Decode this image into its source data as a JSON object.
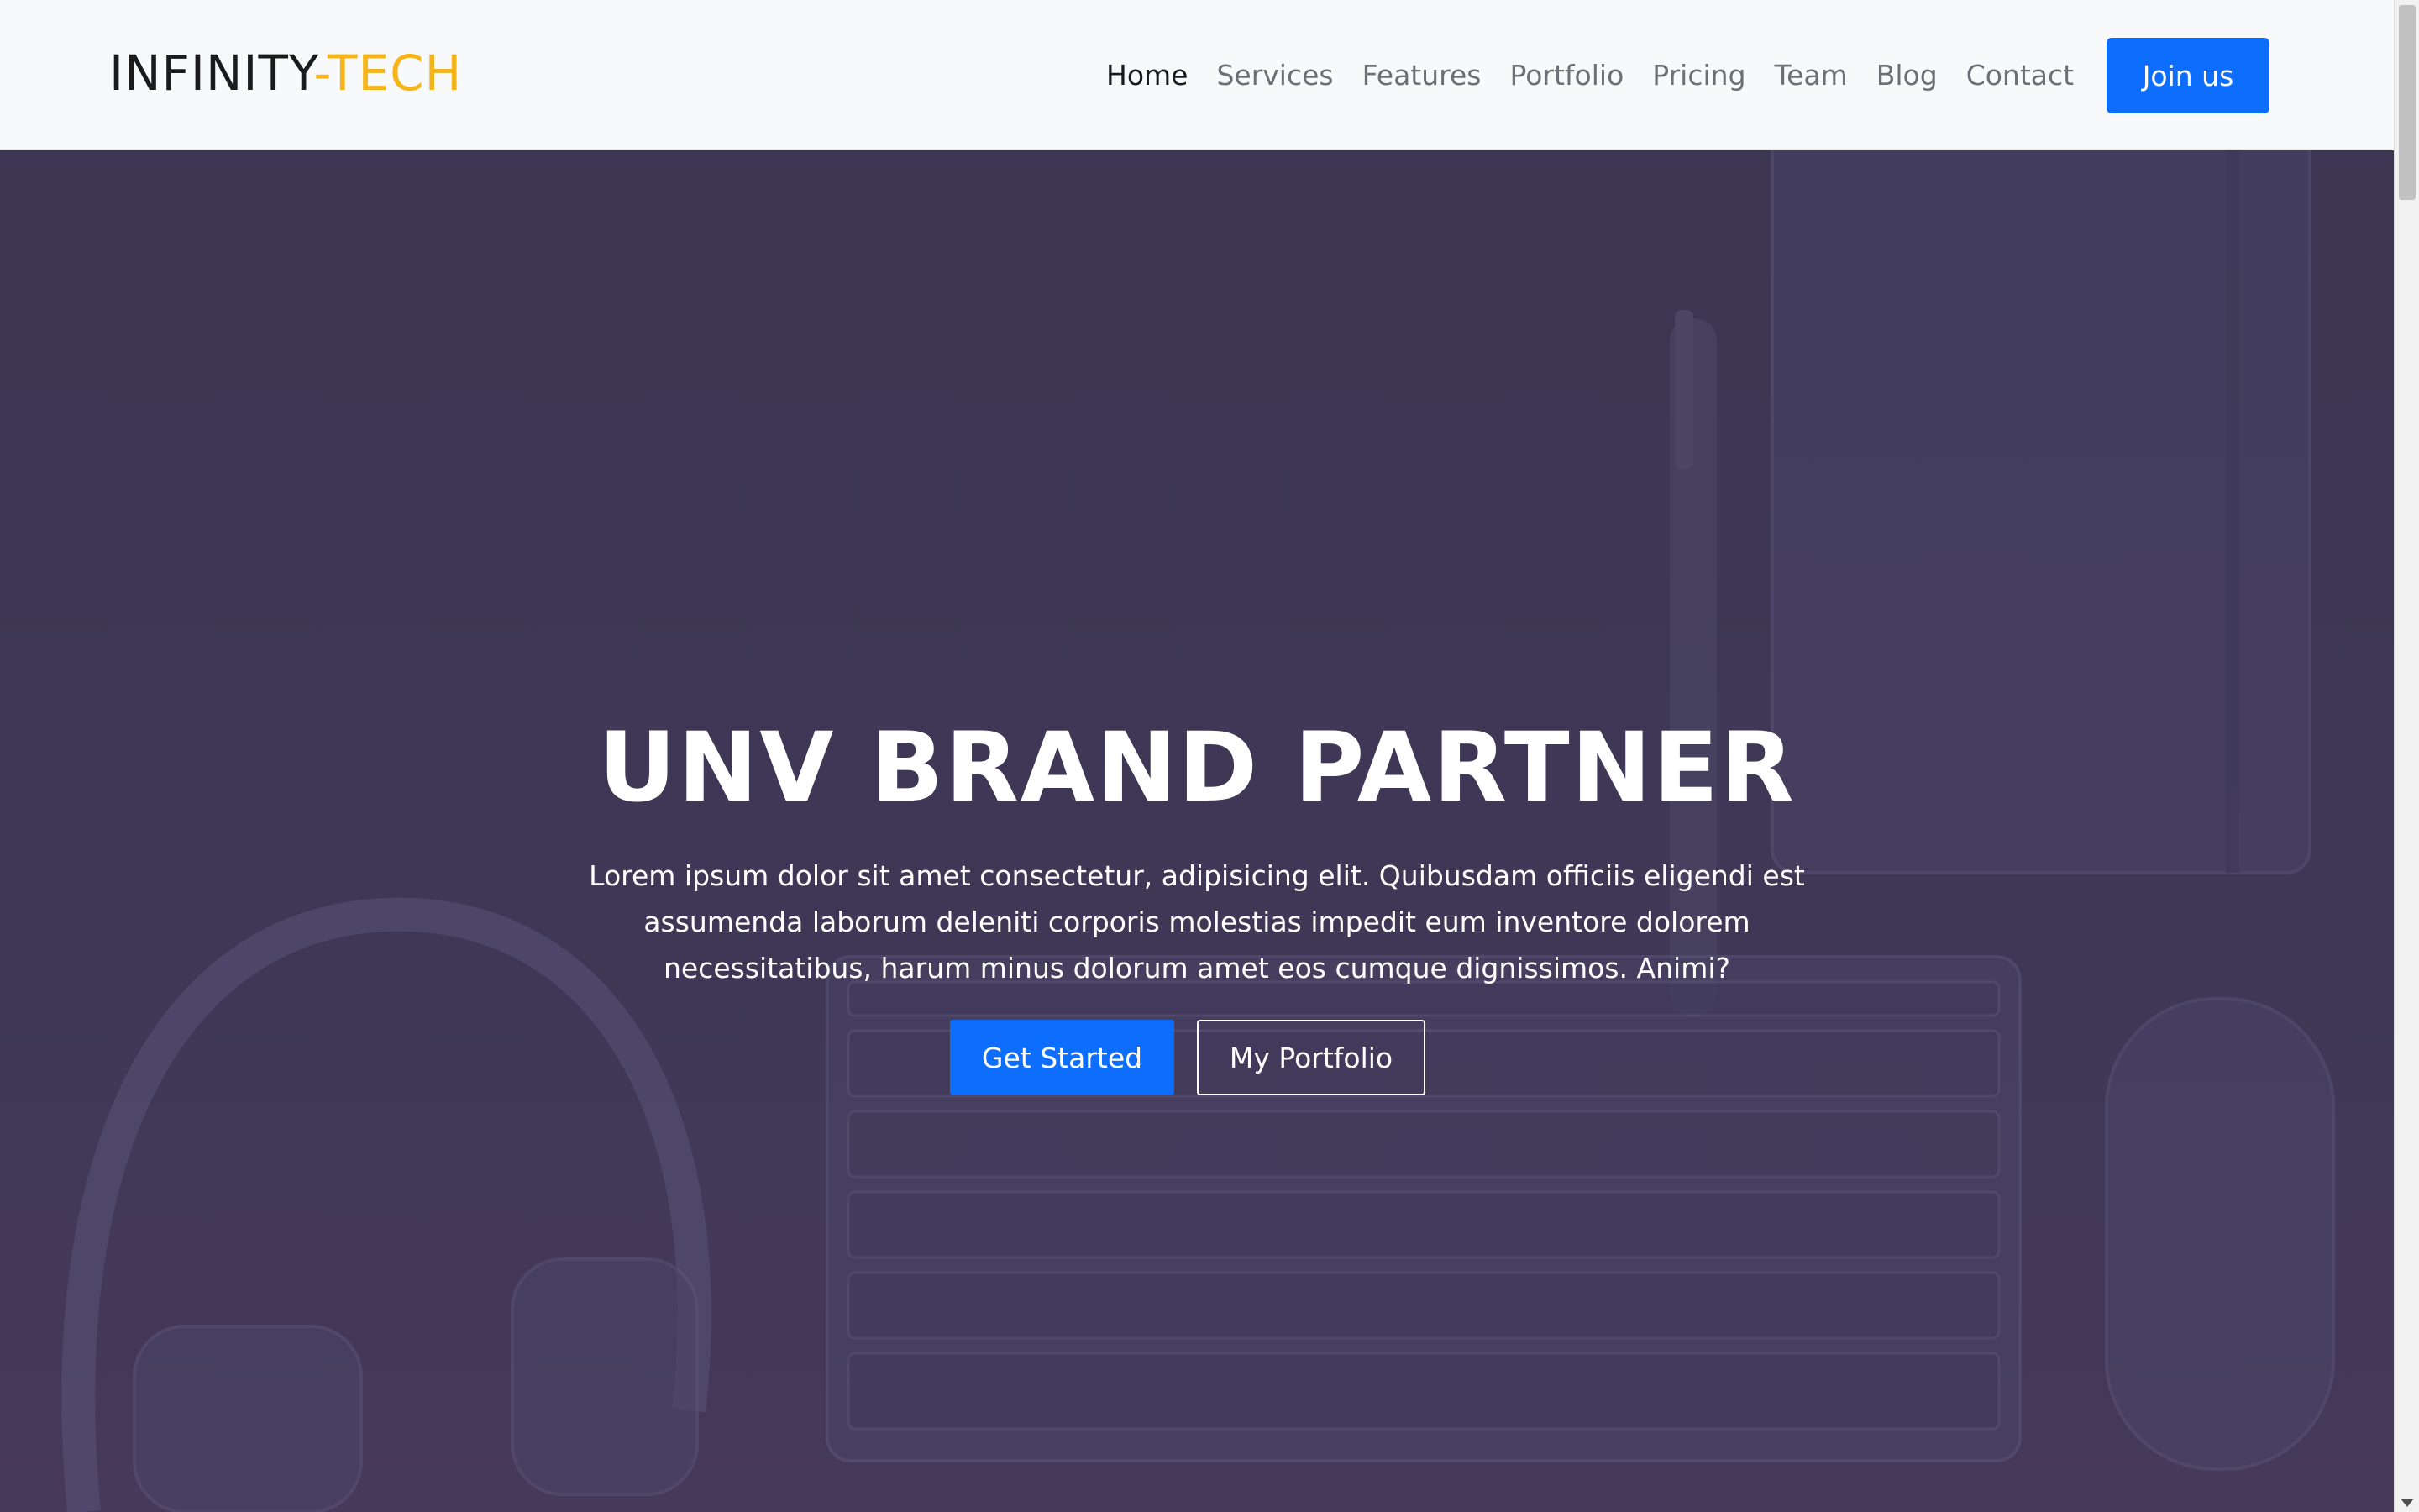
{
  "brand": {
    "name": "INFINITY",
    "accent": "-TECH"
  },
  "nav": {
    "items": [
      {
        "label": "Home",
        "active": true
      },
      {
        "label": "Services",
        "active": false
      },
      {
        "label": "Features",
        "active": false
      },
      {
        "label": "Portfolio",
        "active": false
      },
      {
        "label": "Pricing",
        "active": false
      },
      {
        "label": "Team",
        "active": false
      },
      {
        "label": "Blog",
        "active": false
      },
      {
        "label": "Contact",
        "active": false
      }
    ],
    "cta_label": "Join us"
  },
  "hero": {
    "title": "UNV BRAND PARTNER",
    "text": "Lorem ipsum dolor sit amet consectetur, adipisicing elit. Quibusdam officiis eligendi est assumenda laborum deleniti corporis molestias impedit eum inventore dolorem necessitatibus, harum minus dolorum amet eos cumque dignissimos. Animi?",
    "primary_button": "Get Started",
    "secondary_button": "My Portfolio"
  },
  "colors": {
    "accent": "#f4b41a",
    "primary": "#0d6efd",
    "hero_overlay": "#3d3552"
  }
}
